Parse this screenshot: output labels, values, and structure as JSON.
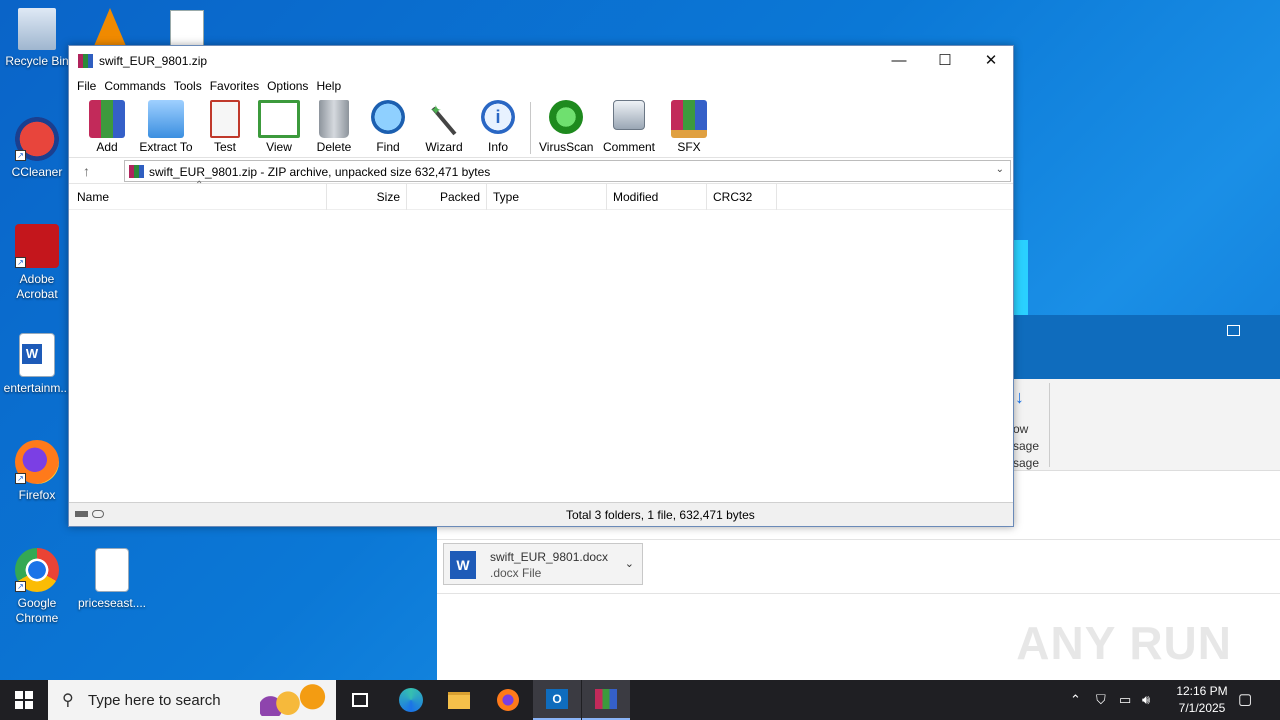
{
  "desktop": {
    "icons": [
      {
        "label": "Recycle Bin"
      },
      {
        "label": "CCleaner"
      },
      {
        "label": "Adobe Acrobat"
      },
      {
        "label": "entertainm..."
      },
      {
        "label": "Firefox"
      },
      {
        "label": "Google Chrome"
      },
      {
        "label": "priceseast...."
      }
    ]
  },
  "background_window": {
    "ribbon_text": [
      "ow",
      "sage",
      "sage"
    ],
    "attachment": {
      "name": "swift_EUR_9801.docx",
      "type": ".docx File"
    },
    "watermark": "ANY RUN"
  },
  "winrar": {
    "title": "swift_EUR_9801.zip",
    "menu": [
      "File",
      "Commands",
      "Tools",
      "Favorites",
      "Options",
      "Help"
    ],
    "toolbar": [
      "Add",
      "Extract To",
      "Test",
      "View",
      "Delete",
      "Find",
      "Wizard",
      "Info",
      "VirusScan",
      "Comment",
      "SFX"
    ],
    "address": "swift_EUR_9801.zip - ZIP archive, unpacked size 632,471 bytes",
    "columns": [
      "Name",
      "Size",
      "Packed",
      "Type",
      "Modified",
      "CRC32"
    ],
    "status": "Total 3 folders, 1 file, 632,471 bytes"
  },
  "taskbar": {
    "search_placeholder": "Type here to search",
    "time": "12:16 PM",
    "date": "7/1/2025"
  }
}
